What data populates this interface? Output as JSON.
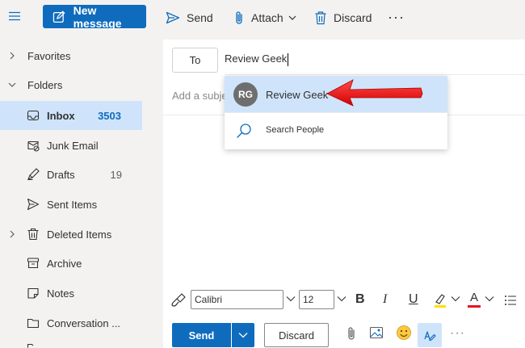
{
  "toolbar": {
    "new_message": "New message",
    "send": "Send",
    "attach": "Attach",
    "discard": "Discard",
    "more": "···"
  },
  "sidebar": {
    "favorites": "Favorites",
    "folders": "Folders",
    "items": [
      {
        "label": "Inbox",
        "count": "3503",
        "icon": "inbox-icon"
      },
      {
        "label": "Junk Email",
        "count": "",
        "icon": "junk-icon"
      },
      {
        "label": "Drafts",
        "count": "19",
        "icon": "drafts-icon"
      },
      {
        "label": "Sent Items",
        "count": "",
        "icon": "sent-icon"
      },
      {
        "label": "Deleted Items",
        "count": "",
        "icon": "trash-icon"
      },
      {
        "label": "Archive",
        "count": "",
        "icon": "archive-icon"
      },
      {
        "label": "Notes",
        "count": "",
        "icon": "notes-icon"
      },
      {
        "label": "Conversation ...",
        "count": "",
        "icon": "folder-icon"
      }
    ]
  },
  "compose": {
    "to_label": "To",
    "to_value": "Review Geek",
    "subject_placeholder": "Add a subje"
  },
  "suggestions": {
    "initials": "RG",
    "name": "Review Geek",
    "search_people": "Search People"
  },
  "format": {
    "font_name": "Calibri",
    "font_size": "12",
    "bold": "B",
    "italic": "I",
    "underline": "U",
    "font_color": "A"
  },
  "actions": {
    "send": "Send",
    "discard": "Discard",
    "more": "···"
  },
  "colors": {
    "accent": "#0f6cbd",
    "selected": "#cfe4fa",
    "arrow": "#e81123"
  }
}
